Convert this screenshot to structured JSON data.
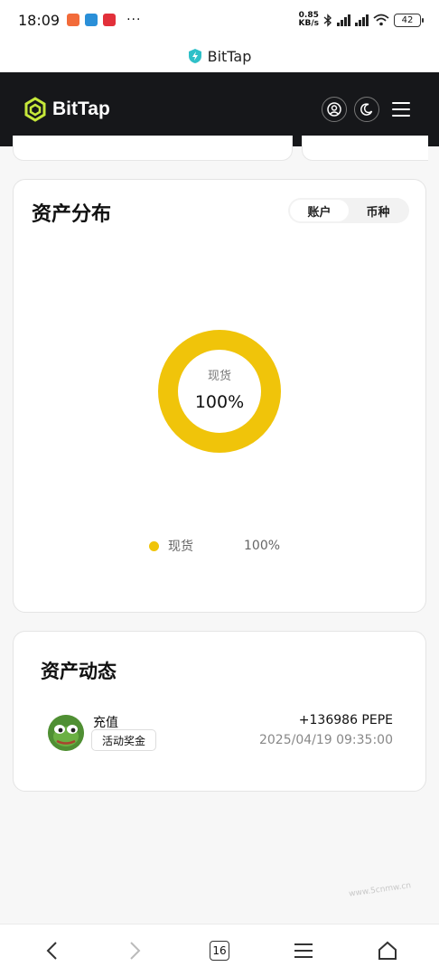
{
  "status_bar": {
    "time": "18:09",
    "dots": "···",
    "speed_top": "0.85",
    "speed_bottom": "KB/s",
    "hd": "HD",
    "battery": "42"
  },
  "url_bar": {
    "title": "BitTap"
  },
  "header": {
    "logo_text": "BitTap"
  },
  "distribution": {
    "title": "资产分布",
    "tabs": [
      {
        "label": "账户",
        "active": true
      },
      {
        "label": "币种",
        "active": false
      }
    ],
    "donut": {
      "label": "现货",
      "value": "100%"
    },
    "legend": [
      {
        "label": "现货",
        "value": "100%"
      }
    ]
  },
  "chart_data": {
    "type": "pie",
    "categories": [
      "现货"
    ],
    "values": [
      100
    ],
    "colors": [
      "#f0c40a"
    ]
  },
  "activity": {
    "title": "资产动态",
    "records": [
      {
        "type": "充值",
        "tag": "活动奖金",
        "amount": "+136986 PEPE",
        "time": "2025/04/19 09:35:00"
      }
    ]
  },
  "bottom_nav": {
    "tabs_count": "16"
  },
  "watermark": "www.5cnmw.cn",
  "colors": {
    "accent": "#f0c40a",
    "header_bg": "#16171a",
    "logo": "#c6e83a"
  }
}
